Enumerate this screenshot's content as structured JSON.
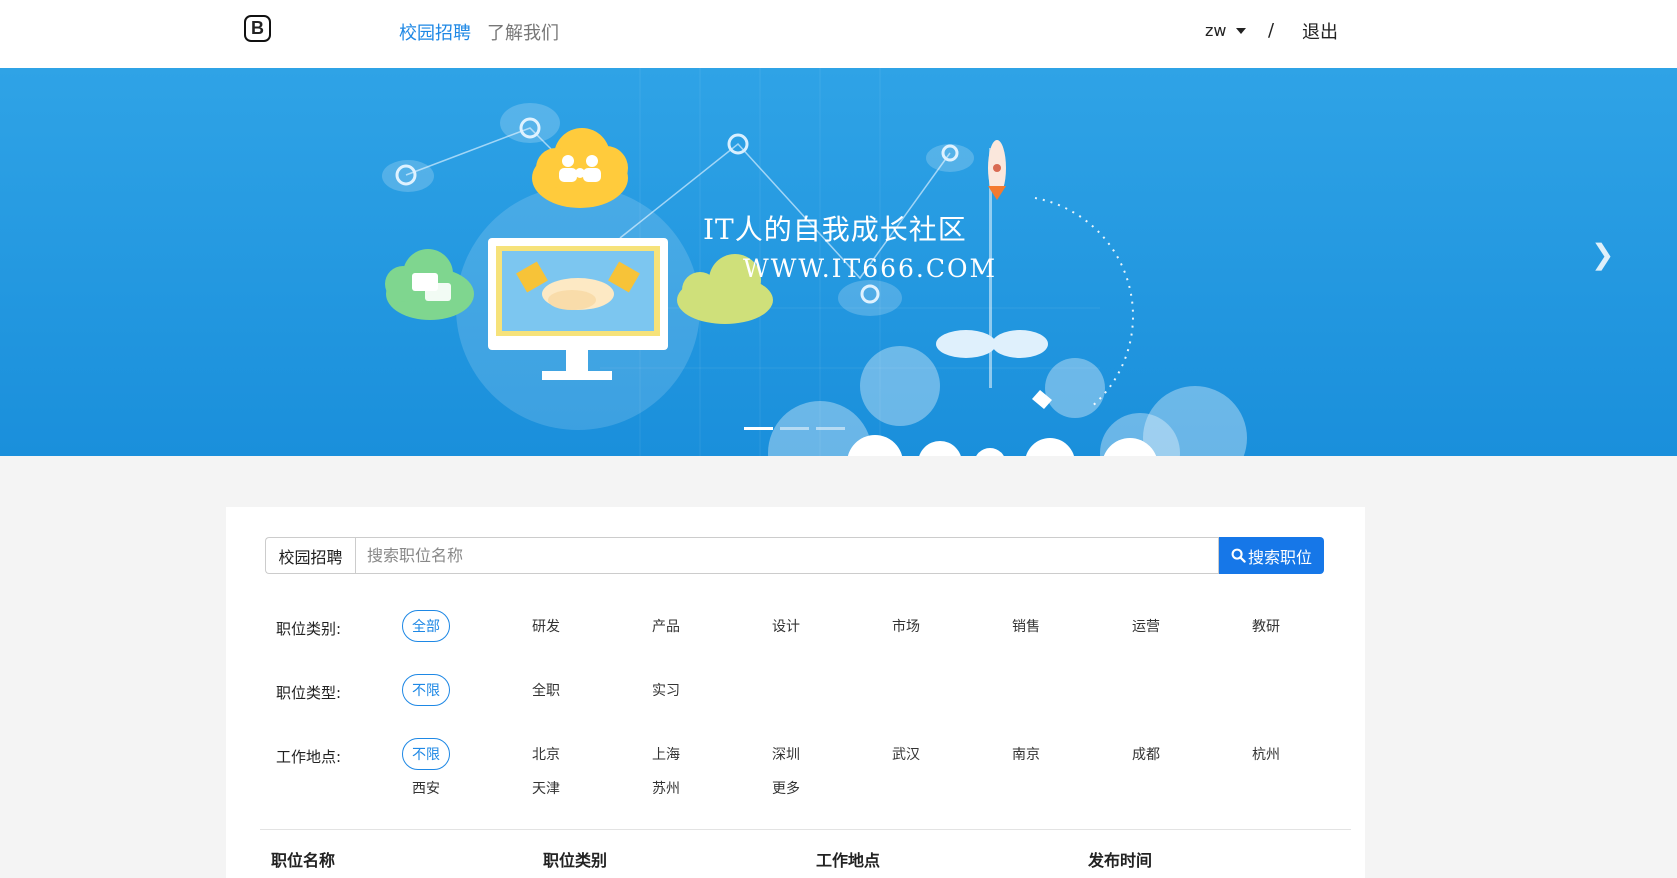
{
  "header": {
    "logo": "B",
    "nav": [
      {
        "label": "校园招聘"
      },
      {
        "label": "了解我们"
      }
    ],
    "user": "zw",
    "separator": "/",
    "logout": "退出"
  },
  "banner": {
    "title": "IT人的自我成长社区",
    "url": "WWW.IT666.COM"
  },
  "search": {
    "prefix": "校园招聘",
    "placeholder": "搜索职位名称",
    "value": "",
    "button": "搜索职位"
  },
  "filters": {
    "category": {
      "label": "职位类别:",
      "options": [
        "全部",
        "研发",
        "产品",
        "设计",
        "市场",
        "销售",
        "运营",
        "教研"
      ],
      "selected": "全部"
    },
    "type": {
      "label": "职位类型:",
      "options": [
        "不限",
        "全职",
        "实习"
      ],
      "selected": "不限"
    },
    "location": {
      "label": "工作地点:",
      "options": [
        "不限",
        "北京",
        "上海",
        "深圳",
        "武汉",
        "南京",
        "成都",
        "杭州",
        "西安",
        "天津",
        "苏州",
        "更多"
      ],
      "selected": "不限"
    }
  },
  "table": {
    "headers": [
      "职位名称",
      "职位类别",
      "工作地点",
      "发布时间"
    ]
  },
  "colors": {
    "accent": "#1e88e5",
    "button": "#1677e8",
    "banner": "#1a8fdb"
  }
}
